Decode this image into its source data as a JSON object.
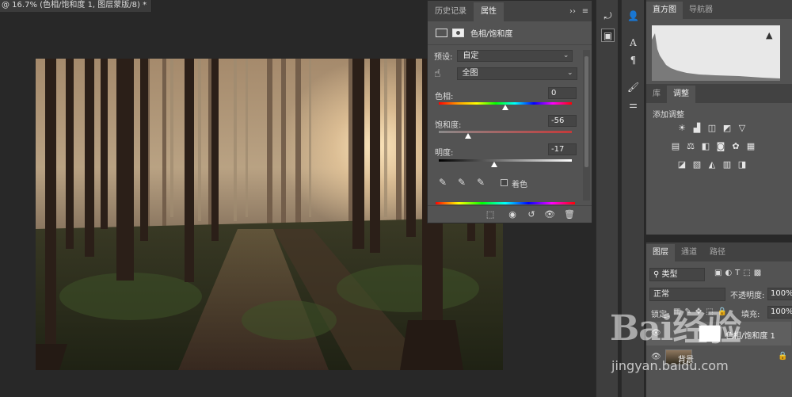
{
  "document": {
    "tab_title": "@ 16.7% (色相/饱和度 1, 图层蒙版/8) *",
    "close_glyph": "×"
  },
  "properties_panel": {
    "tabs": [
      "历史记录",
      "属性"
    ],
    "active_tab": "属性",
    "collapse_glyph": "››",
    "menu_glyph": "≡",
    "title": "色相/饱和度",
    "preset_label": "预设:",
    "preset_value": "自定",
    "channel_value": "全图",
    "hue_label": "色相:",
    "hue_value": "0",
    "saturation_label": "饱和度:",
    "saturation_value": "-56",
    "lightness_label": "明度:",
    "lightness_value": "-17",
    "colorize_label": "着色",
    "colorize_checked": false,
    "slider_levels": {
      "hue": 0,
      "saturation": -56,
      "lightness": -17
    }
  },
  "histogram_panel": {
    "tabs": [
      "直方图",
      "导航器"
    ],
    "active_tab": "直方图",
    "warning_glyph": "▲"
  },
  "adjustments_panel": {
    "tabs": [
      "库",
      "调整"
    ],
    "active_tab": "调整",
    "heading": "添加调整"
  },
  "layers_panel": {
    "tabs": [
      "图层",
      "通道",
      "路径"
    ],
    "active_tab": "图层",
    "filter_kind": "类型",
    "blend_mode": "正常",
    "opacity_label": "不透明度:",
    "opacity_value": "100%",
    "lock_label": "锁定:",
    "fill_label": "填充:",
    "fill_value": "100%",
    "layers": [
      {
        "name": "色相/饱和度 1",
        "type": "adjustment"
      },
      {
        "name": "背景",
        "type": "background"
      }
    ]
  },
  "watermark": {
    "brand": "Bai经验",
    "url": "jingyan.baidu.com"
  },
  "colors": {
    "panel_bg": "#535353",
    "panel_tab_bg": "#424242",
    "app_bg": "#282828",
    "input_bg": "#454545"
  }
}
